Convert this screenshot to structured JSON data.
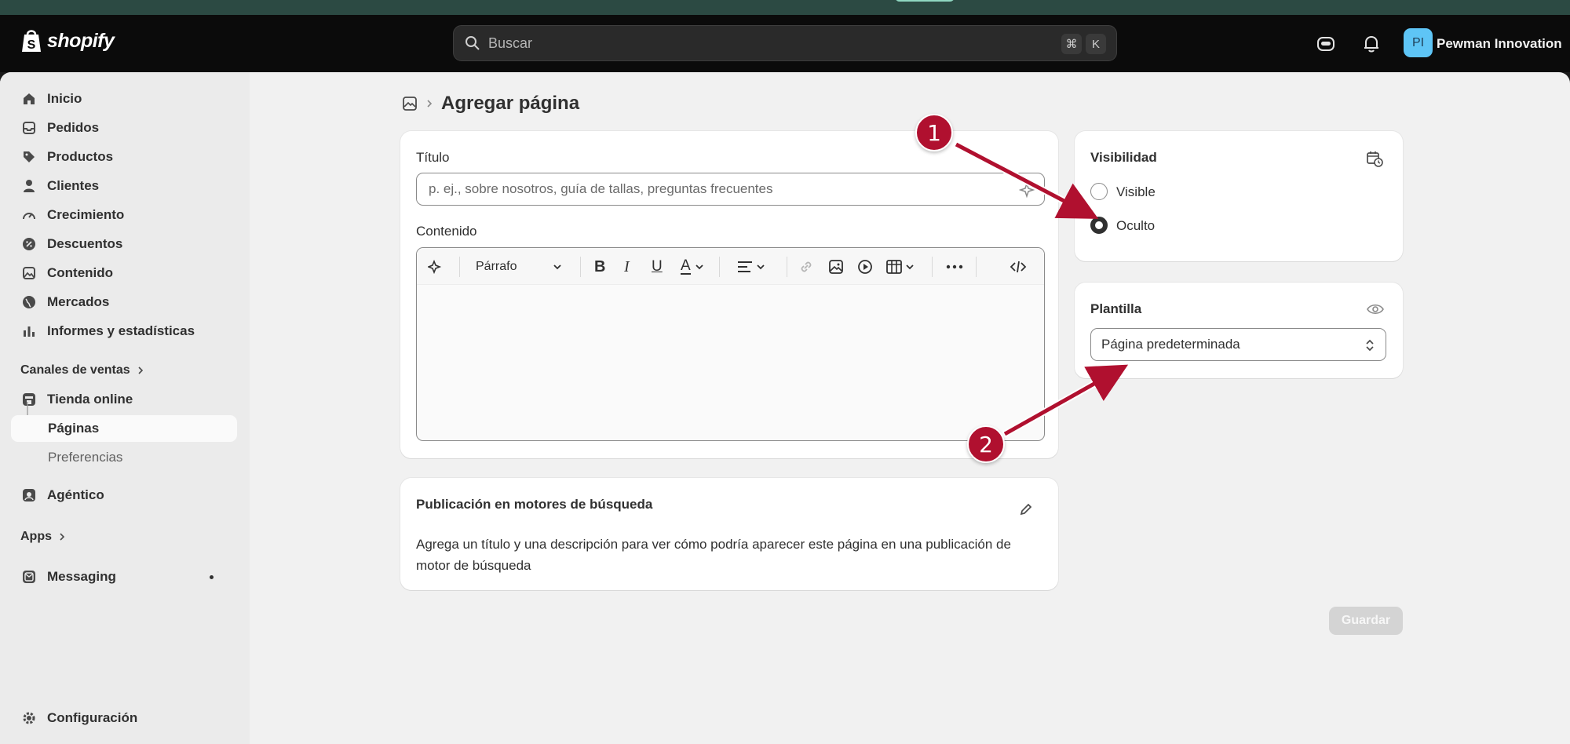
{
  "app": {
    "brand": "shopify",
    "store_name": "Pewman Innovation",
    "avatar_initials": "PI"
  },
  "search": {
    "placeholder": "Buscar",
    "shortcut_cmd": "⌘",
    "shortcut_key": "K"
  },
  "sidebar": {
    "items": [
      {
        "label": "Inicio",
        "icon": "home-icon"
      },
      {
        "label": "Pedidos",
        "icon": "inbox-icon"
      },
      {
        "label": "Productos",
        "icon": "tag-icon"
      },
      {
        "label": "Clientes",
        "icon": "person-icon"
      },
      {
        "label": "Crecimiento",
        "icon": "gauge-icon"
      },
      {
        "label": "Descuentos",
        "icon": "discount-icon"
      },
      {
        "label": "Contenido",
        "icon": "image-icon"
      },
      {
        "label": "Mercados",
        "icon": "globe-icon"
      },
      {
        "label": "Informes y estadísticas",
        "icon": "bar-chart-icon"
      }
    ],
    "sales_channels_label": "Canales de ventas",
    "online_store_label": "Tienda online",
    "pages_label": "Páginas",
    "preferences_label": "Preferencias",
    "agentic_label": "Agéntico",
    "apps_label": "Apps",
    "messaging_label": "Messaging",
    "settings_label": "Configuración"
  },
  "page": {
    "title": "Agregar página"
  },
  "form": {
    "title_label": "Título",
    "title_placeholder": "p. ej., sobre nosotros, guía de tallas, preguntas frecuentes",
    "content_label": "Contenido",
    "paragraph_select": "Párrafo"
  },
  "visibility": {
    "heading": "Visibilidad",
    "options": [
      "Visible",
      "Oculto"
    ],
    "selected": "Oculto"
  },
  "template": {
    "heading": "Plantilla",
    "value": "Página predeterminada"
  },
  "seo": {
    "heading": "Publicación en motores de búsqueda",
    "description": "Agrega un título y una descripción para ver cómo podría aparecer este página en una publicación de motor de búsqueda"
  },
  "actions": {
    "save_label": "Guardar"
  },
  "annotations": {
    "badge_1": "1",
    "badge_2": "2",
    "color": "#b0102f"
  }
}
